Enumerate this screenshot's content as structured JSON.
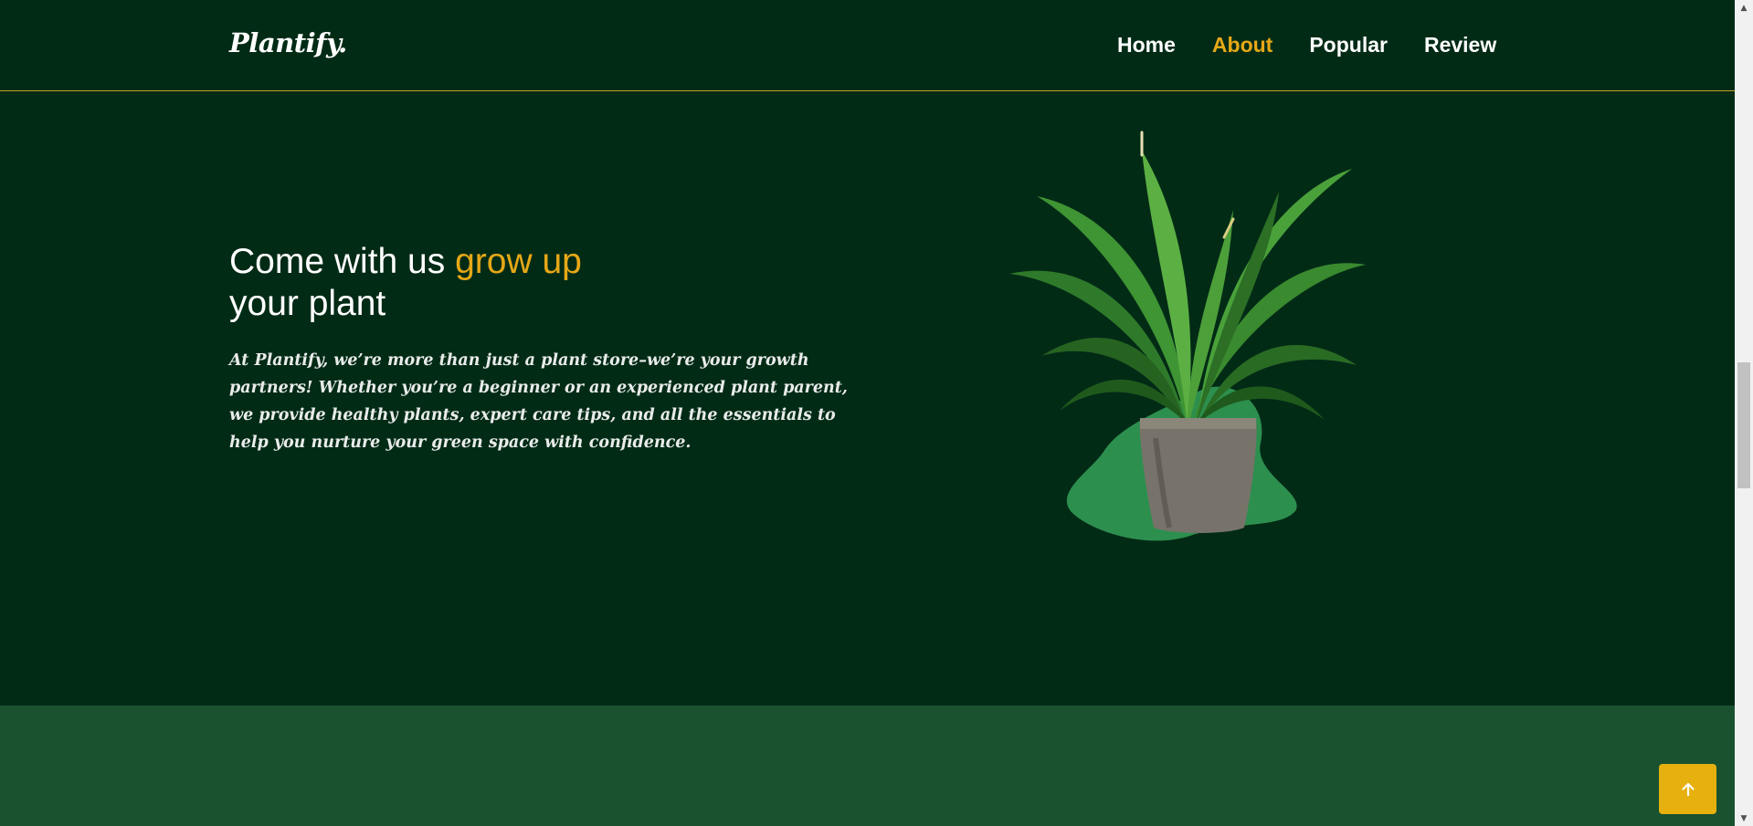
{
  "header": {
    "logo": "Plantify.",
    "nav": [
      {
        "label": "Home",
        "active": false
      },
      {
        "label": "About",
        "active": true
      },
      {
        "label": "Popular",
        "active": false
      },
      {
        "label": "Review",
        "active": false
      }
    ]
  },
  "hero": {
    "title_part1": "Come with us ",
    "title_accent": "grow up",
    "title_part2": "your plant",
    "description": "At Plantify, we’re more than just a plant store–we’re your growth partners! Whether you’re a beginner or an experienced plant parent, we provide healthy plants, expert care tips, and all the essentials to help you nurture your green space with confidence."
  },
  "scroll_top": {
    "icon": "arrow-up-icon"
  },
  "colors": {
    "background": "#022b16",
    "accent": "#e6a817",
    "lower_section": "#1a5230",
    "blob": "#2d8f4e"
  }
}
